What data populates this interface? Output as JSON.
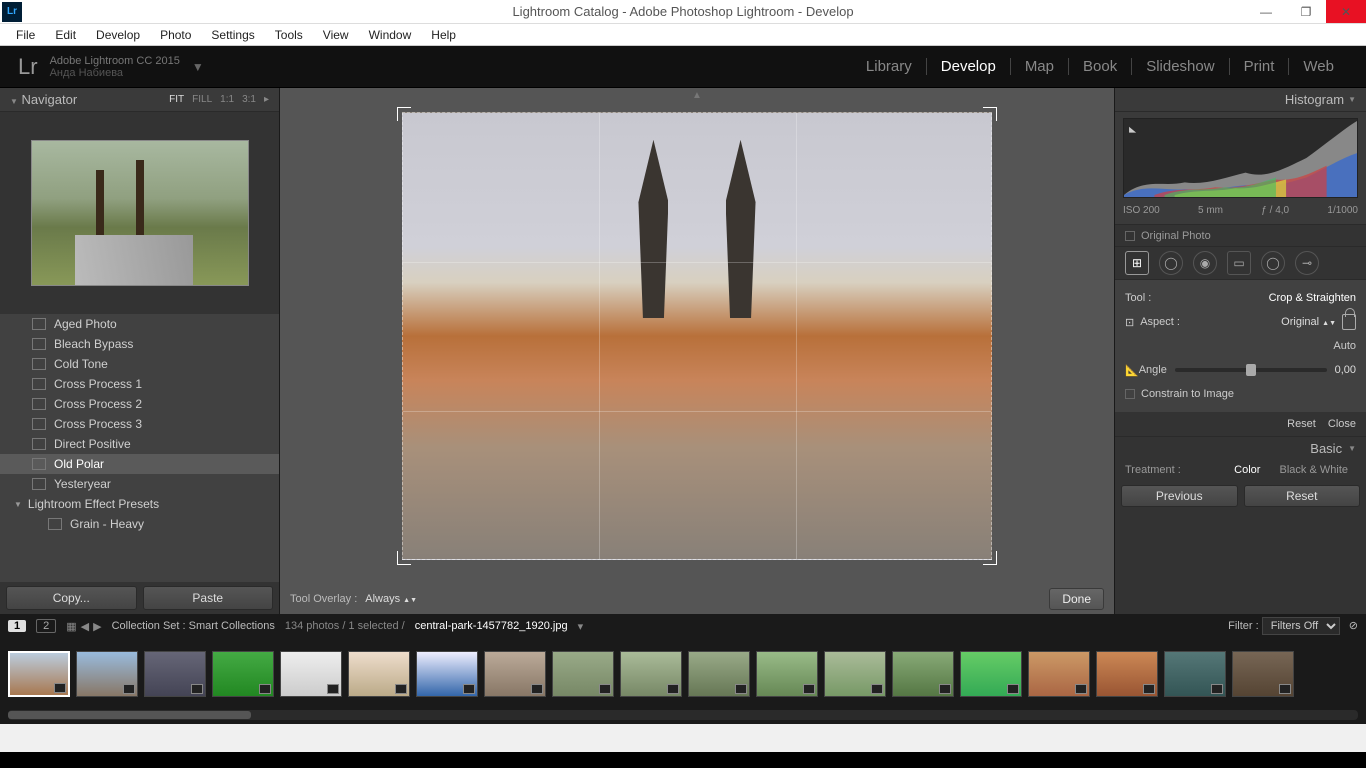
{
  "window": {
    "title": "Lightroom Catalog - Adobe Photoshop Lightroom - Develop",
    "menu": [
      "File",
      "Edit",
      "Develop",
      "Photo",
      "Settings",
      "Tools",
      "View",
      "Window",
      "Help"
    ]
  },
  "header": {
    "brand": "Lr",
    "version": "Adobe Lightroom CC 2015",
    "user": "Анда Набиева",
    "modules": [
      "Library",
      "Develop",
      "Map",
      "Book",
      "Slideshow",
      "Print",
      "Web"
    ],
    "active_module": "Develop"
  },
  "navigator": {
    "title": "Navigator",
    "zoom": [
      "FIT",
      "FILL",
      "1:1",
      "3:1"
    ]
  },
  "presets": {
    "items": [
      "Aged Photo",
      "Bleach Bypass",
      "Cold Tone",
      "Cross Process 1",
      "Cross Process 2",
      "Cross Process 3",
      "Direct Positive",
      "Old Polar",
      "Yesteryear"
    ],
    "selected": "Old Polar",
    "group": "Lightroom Effect Presets",
    "subitems": [
      "Grain - Heavy"
    ]
  },
  "left_buttons": {
    "copy": "Copy...",
    "paste": "Paste"
  },
  "center": {
    "overlay_label": "Tool Overlay :",
    "overlay_value": "Always",
    "done": "Done"
  },
  "histogram": {
    "title": "Histogram",
    "iso": "ISO 200",
    "focal": "5 mm",
    "aperture": "ƒ / 4,0",
    "shutter": "1/1000",
    "original": "Original Photo"
  },
  "crop": {
    "tool_label": "Tool :",
    "tool_value": "Crop & Straighten",
    "aspect_label": "Aspect :",
    "aspect_value": "Original",
    "auto": "Auto",
    "angle_label": "Angle",
    "angle_value": "0,00",
    "constrain": "Constrain to Image",
    "reset": "Reset",
    "close": "Close"
  },
  "basic": {
    "title": "Basic",
    "treatment_label": "Treatment :",
    "color": "Color",
    "bw": "Black & White"
  },
  "right_buttons": {
    "previous": "Previous",
    "reset": "Reset"
  },
  "filmstrip": {
    "page1": "1",
    "page2": "2",
    "collection_label": "Collection Set : Smart Collections",
    "count": "134 photos / 1 selected /",
    "filename": "central-park-1457782_1920.jpg",
    "filter_label": "Filter :",
    "filter_value": "Filters Off"
  }
}
